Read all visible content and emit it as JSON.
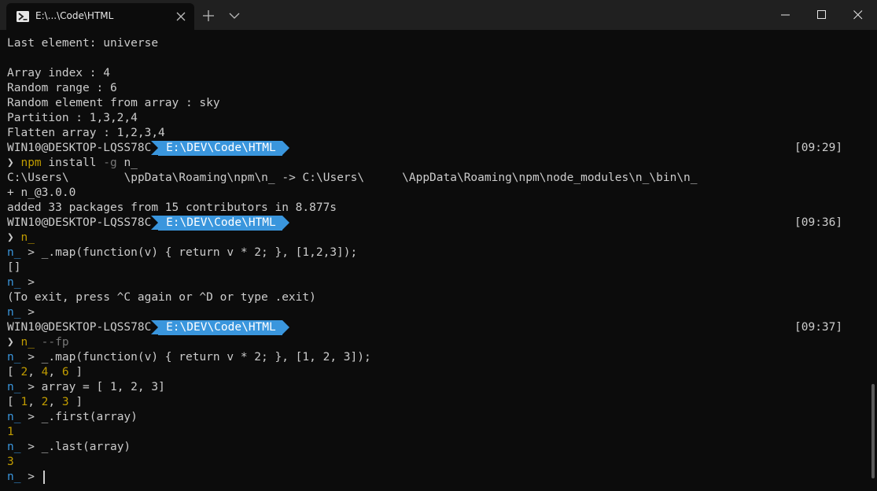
{
  "tab": {
    "title": "E:\\...\\Code\\HTML"
  },
  "lines": {
    "l0": "Last element: universe",
    "l1": "Array index : 4",
    "l2": "Random range : 6",
    "l3": "Random element from array : sky",
    "l4": "Partition : 1,3,2,4",
    "l5": "Flatten array : 1,2,3,4",
    "prompt1_user": "WIN10@DESKTOP-LQSS78C",
    "prompt1_path": "E:\\DEV\\Code\\HTML",
    "prompt1_time": "[09:29]",
    "cmd1_npm": "npm",
    "cmd1_rest1": "install ",
    "cmd1_flag": "-g",
    "cmd1_rest2": " n_",
    "l_link_a": "C:\\Users\\",
    "l_link_b": "\\ppData\\Roaming\\npm\\n_ -> C:\\Users\\",
    "l_link_c": "\\AppData\\Roaming\\npm\\node_modules\\n_\\bin\\n_",
    "l_ver": "+ n_@3.0.0",
    "l_added": "added 33 packages from 15 contributors in 8.877s",
    "prompt2_user": "WIN10@DESKTOP-LQSS78C",
    "prompt2_path": "E:\\DEV\\Code\\HTML",
    "prompt2_time": "[09:36]",
    "cmd2": "n_",
    "repl_prompt": "n_",
    "repl_gt": " > ",
    "r1_expr": "_.map(function(v) { return v * 2; }, [1,2,3]);",
    "r1_out": "[]",
    "r3_exit": "(To exit, press ^C again or ^D or type .exit)",
    "prompt3_user": "WIN10@DESKTOP-LQSS78C",
    "prompt3_path": "E:\\DEV\\Code\\HTML",
    "prompt3_time": "[09:37]",
    "cmd3": "n_",
    "cmd3_flag": " --fp",
    "r4_expr": "_.map(function(v) { return v * 2; }, [1, 2, 3]);",
    "r4_out_a": "[ ",
    "r4_out_n1": "2",
    "r4_out_n2": "4",
    "r4_out_n3": "6",
    "r4_out_end": " ]",
    "comma": ", ",
    "r5_expr": "array = [ 1, 2, 3]",
    "r5_out_n1": "1",
    "r5_out_n2": "2",
    "r5_out_n3": "3",
    "r6_expr": "_.first(array)",
    "r6_out": "1",
    "r7_expr": "_.last(array)",
    "r7_out": "3",
    "prompt_chevron": "❯"
  }
}
